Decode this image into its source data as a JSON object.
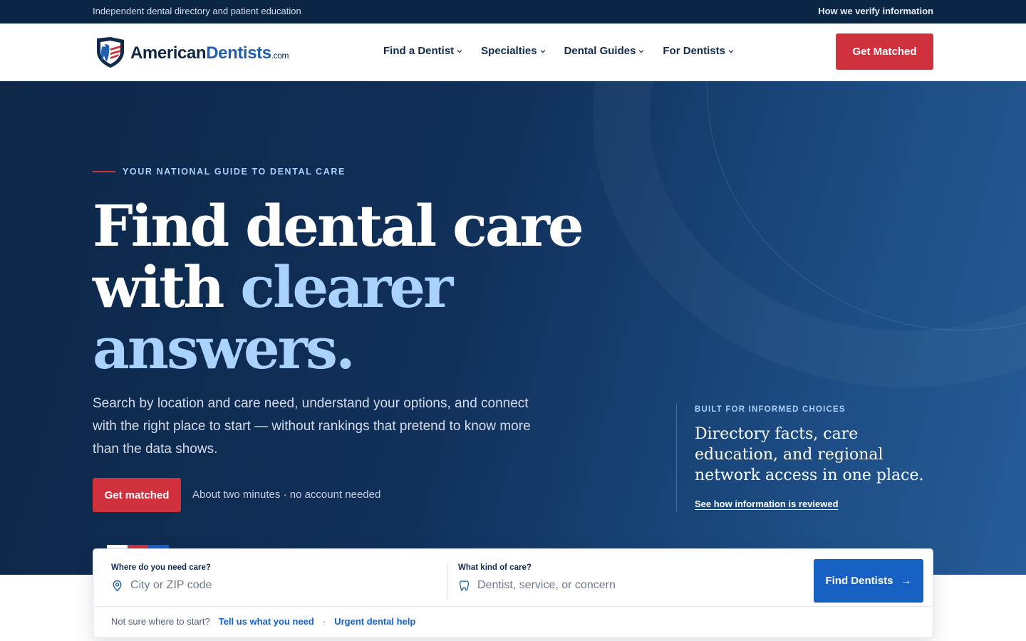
{
  "utility": {
    "tagline": "Independent dental directory and patient education",
    "verify_link": "How we verify information"
  },
  "header": {
    "logo": {
      "part1": "American",
      "part2": "Dentists",
      "part3": ".com"
    },
    "nav": [
      {
        "label": "Find a Dentist"
      },
      {
        "label": "Specialties"
      },
      {
        "label": "Dental Guides"
      },
      {
        "label": "For Dentists"
      }
    ],
    "cta": "Get Matched"
  },
  "hero": {
    "eyebrow": "YOUR NATIONAL GUIDE TO DENTAL CARE",
    "headline_line1": "Find dental care",
    "headline_with": "with ",
    "headline_accent1": "clearer",
    "headline_accent2": "answers.",
    "subcopy": "Search by location and care need, understand your options, and connect with the right place to start — without rankings that pretend to know more than the data shows.",
    "cta": "Get matched",
    "cta_note": "About two minutes · no account needed"
  },
  "info_panel": {
    "kicker": "BUILT FOR INFORMED CHOICES",
    "title": "Directory facts, care education, and regional network access in one place.",
    "link": "See how information is reviewed"
  },
  "search": {
    "location_label": "Where do you need care?",
    "location_placeholder": "City or ZIP code",
    "care_label": "What kind of care?",
    "care_placeholder": "Dentist, service, or concern",
    "button": "Find Dentists",
    "button_arrow": "→",
    "helper_text": "Not sure where to start?",
    "helper_link1": "Tell us what you need",
    "helper_sep": "·",
    "helper_link2": "Urgent dental help"
  },
  "colors": {
    "navy": "#0b2545",
    "brand_red": "#d0313d",
    "brand_blue": "#1760c4",
    "accent_light_blue": "#a9d2ff"
  },
  "icons": {
    "logo": "tooth-shield-logo-icon",
    "location": "map-pin-icon",
    "care": "tooth-icon",
    "nav_chevron": "chevron-down-icon"
  }
}
